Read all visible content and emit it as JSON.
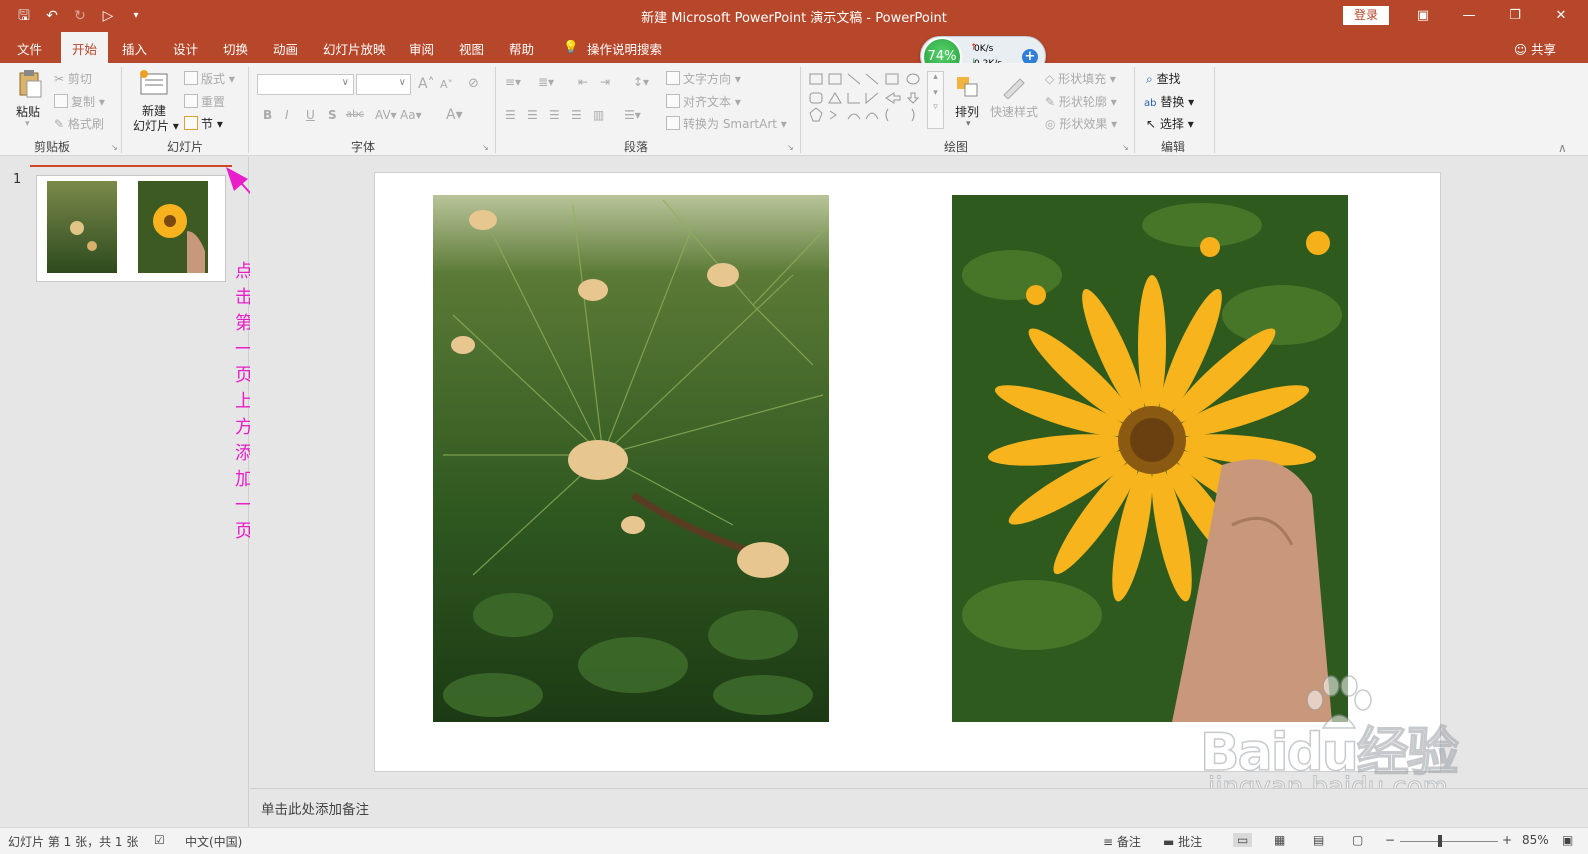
{
  "window": {
    "title": "新建 Microsoft PowerPoint 演示文稿  -  PowerPoint",
    "login_label": "登录"
  },
  "colors": {
    "brand": "#b7472a",
    "annotation": "#e91ec9"
  },
  "tabs": [
    "文件",
    "开始",
    "插入",
    "设计",
    "切换",
    "动画",
    "幻灯片放映",
    "审阅",
    "视图",
    "帮助",
    "操作说明搜索"
  ],
  "active_tab": "开始",
  "share_label": "共享",
  "net_widget": {
    "percent": "74%",
    "up": "0K/s",
    "down": "0.2K/s"
  },
  "ribbon": {
    "clipboard": {
      "paste": "粘贴",
      "cut": "剪切",
      "copy": "复制",
      "format_painter": "格式刷",
      "label": "剪贴板"
    },
    "slides": {
      "new_slide_1": "新建",
      "new_slide_2": "幻灯片",
      "layout": "版式",
      "reset": "重置",
      "section": "节",
      "label": "幻灯片"
    },
    "font": {
      "bold": "B",
      "italic": "I",
      "underline": "U",
      "shadow": "S",
      "strike": "abc",
      "case": "Aa",
      "label": "字体"
    },
    "paragraph": {
      "text_direction": "文字方向",
      "align_text": "对齐文本",
      "smartart": "转换为 SmartArt",
      "label": "段落"
    },
    "drawing": {
      "arrange": "排列",
      "quick_styles": "快速样式",
      "shape_fill": "形状填充",
      "shape_outline": "形状轮廓",
      "shape_effects": "形状效果",
      "label": "绘图"
    },
    "editing": {
      "find": "查找",
      "replace": "替换",
      "select": "选择",
      "label": "编辑"
    }
  },
  "slides_pane": {
    "slide_number": "1",
    "annotation": "点击第一页上方添加一页"
  },
  "notes_placeholder": "单击此处添加备注",
  "status": {
    "slide_info": "幻灯片 第 1 张，共 1 张",
    "language": "中文(中国)",
    "notes": "备注",
    "comments": "批注",
    "zoom": "85%"
  },
  "watermark": {
    "main": "Baidu经验",
    "sub": "jingyan.baidu.com"
  }
}
